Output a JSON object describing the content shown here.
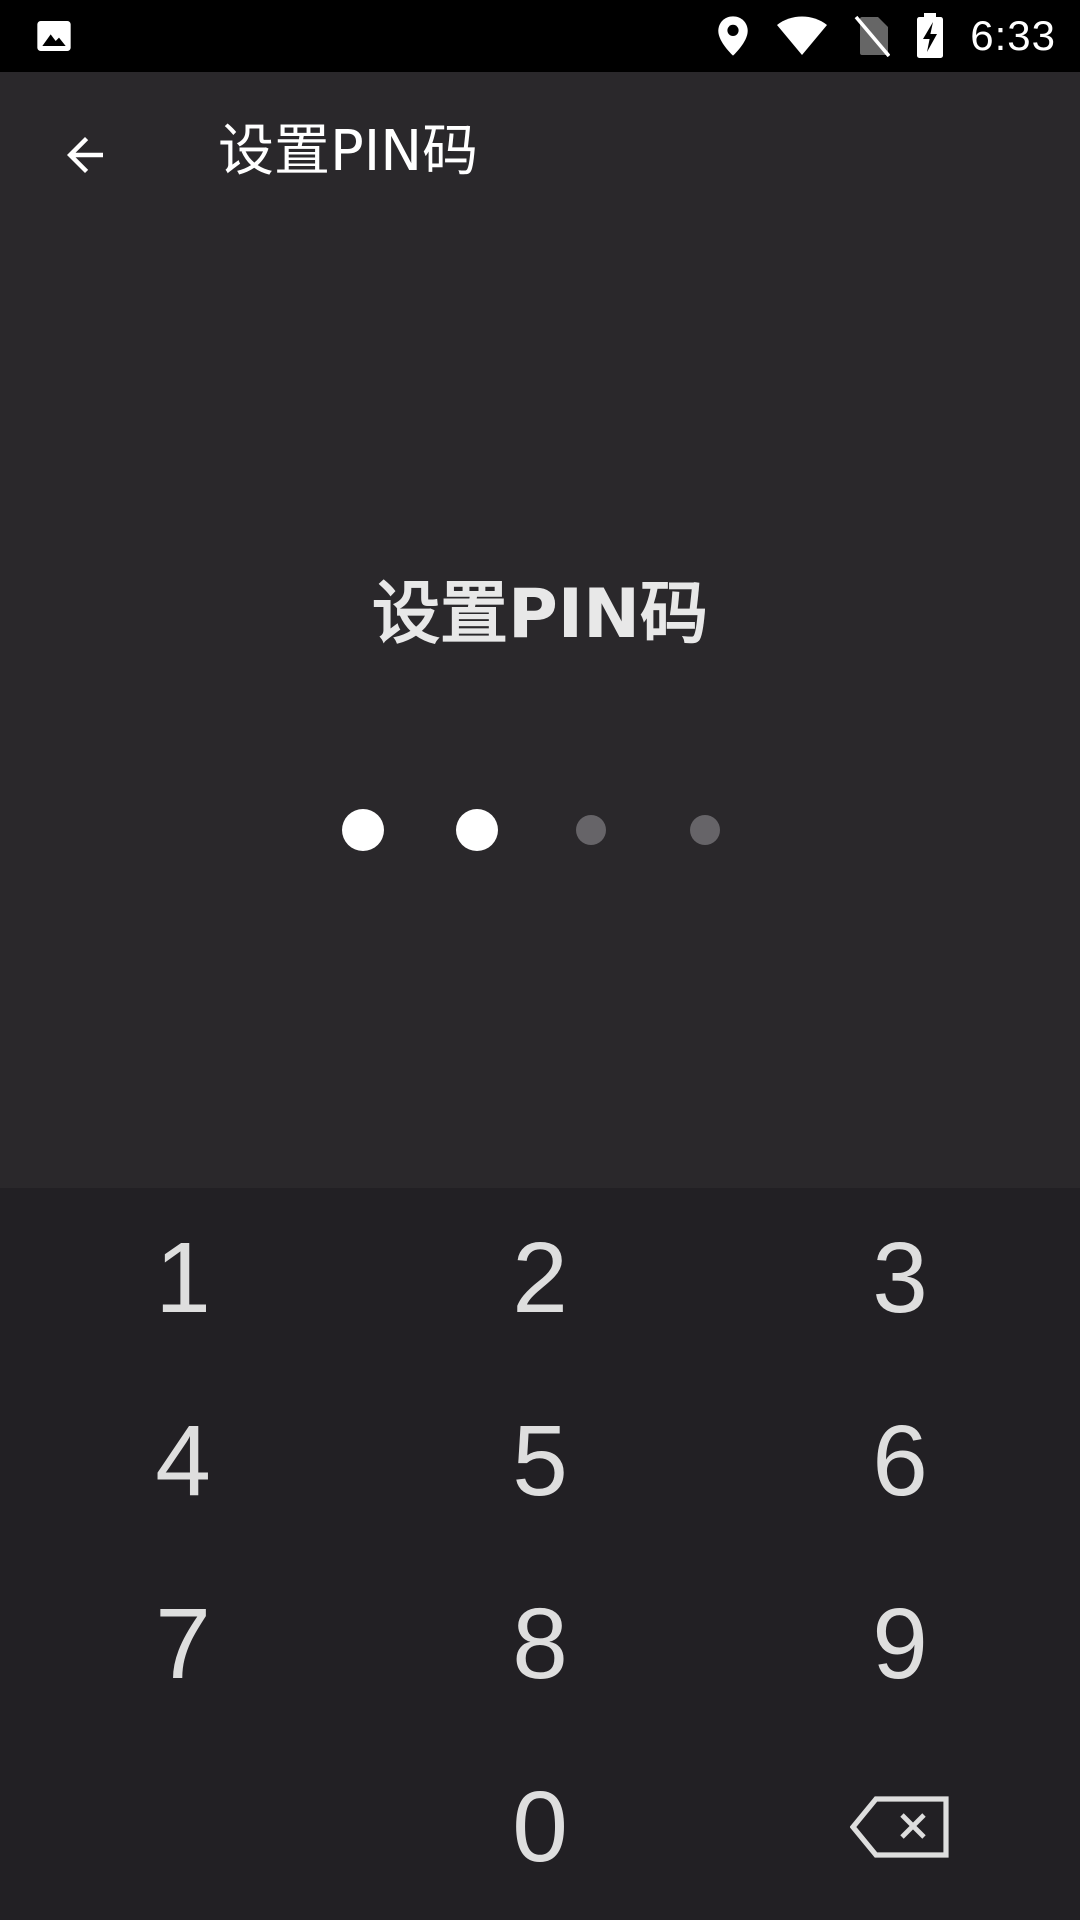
{
  "status_bar": {
    "time": "6:33",
    "icons": [
      "image-icon",
      "location-icon",
      "wifi-icon",
      "no-sim-icon",
      "battery-charging-icon"
    ]
  },
  "app_bar": {
    "title": "设置PIN码",
    "back_icon": "arrow-back-icon"
  },
  "prompt": "设置PIN码",
  "pin": {
    "length": 4,
    "entered": 2
  },
  "keypad": {
    "keys": [
      "1",
      "2",
      "3",
      "4",
      "5",
      "6",
      "7",
      "8",
      "9",
      "0"
    ],
    "delete_icon": "backspace-icon"
  },
  "colors": {
    "background": "#2a282b",
    "keypad_background": "#222024",
    "status_bar": "#000000",
    "dot_filled": "#ffffff",
    "dot_empty": "#666468",
    "key_text": "#dedede"
  }
}
